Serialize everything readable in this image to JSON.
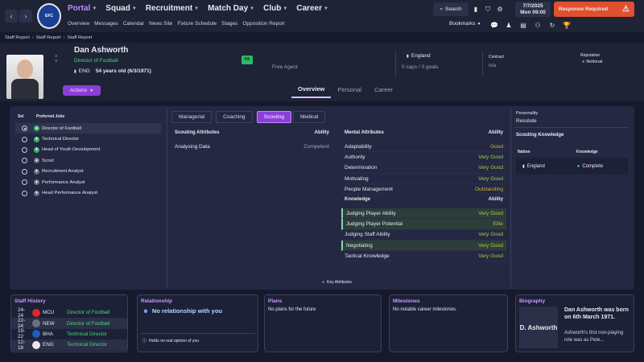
{
  "topbar": {
    "nav_items": [
      {
        "label": "Portal"
      },
      {
        "label": "Squad"
      },
      {
        "label": "Recruitment"
      },
      {
        "label": "Match Day"
      },
      {
        "label": "Club"
      },
      {
        "label": "Career"
      }
    ],
    "sub_nav": [
      "Overview",
      "Messages",
      "Calendar",
      "News Site",
      "Fixture Schedule",
      "Stages",
      "Opposition Report"
    ],
    "search_label": "Search",
    "date": "7/7/2025",
    "day_time": "Mon 09:00",
    "response_label": "Response Required",
    "bookmarks_label": "Bookmarks"
  },
  "breadcrumb": [
    "Staff Report",
    "Staff Report",
    "Staff Report"
  ],
  "profile": {
    "name": "Dan Ashworth",
    "role": "Director of Football",
    "nation_code": "ENG",
    "age": "54 years old (6/3/1971)",
    "fa_badge": "FA",
    "status": "Free Agent",
    "nation": "England",
    "caps": "0 caps / 0 goals",
    "contract_label": "Contract",
    "contract_value": "n/a",
    "reputation_label": "Reputation",
    "reputation_value": "Notional",
    "actions_label": "Actions"
  },
  "view_tabs": [
    "Overview",
    "Personal",
    "Career"
  ],
  "preferred_jobs": {
    "sel_header": "Sel",
    "jobs_header": "Preferred Jobs",
    "items": [
      {
        "label": "Director of Football",
        "selected": true
      },
      {
        "label": "Technical Director",
        "selected": false
      },
      {
        "label": "Head of Youth Development",
        "selected": false
      },
      {
        "label": "Scout",
        "selected": false
      },
      {
        "label": "Recruitment Analyst",
        "selected": false
      },
      {
        "label": "Performance Analyst",
        "selected": false
      },
      {
        "label": "Head Performance Analyst",
        "selected": false
      }
    ]
  },
  "attr_tabs": [
    "Managerial",
    "Coaching",
    "Scouting",
    "Medical"
  ],
  "scouting": {
    "header": "Scouting Attributes",
    "ability_header": "Ability",
    "rows": [
      {
        "name": "Analysing Data",
        "value": "Competent"
      }
    ]
  },
  "mental": {
    "header": "Mental Attributes",
    "ability_header": "Ability",
    "rows": [
      {
        "name": "Adaptability",
        "value": "Good"
      },
      {
        "name": "Authority",
        "value": "Very Good"
      },
      {
        "name": "Determination",
        "value": "Very Good"
      },
      {
        "name": "Motivating",
        "value": "Very Good"
      },
      {
        "name": "People Management",
        "value": "Outstanding"
      }
    ]
  },
  "knowledge": {
    "header": "Knowledge",
    "ability_header": "Ability",
    "rows": [
      {
        "name": "Judging Player Ability",
        "value": "Very Good",
        "key": true
      },
      {
        "name": "Judging Player Potential",
        "value": "Elite",
        "key": true
      },
      {
        "name": "Judging Staff Ability",
        "value": "Very Good",
        "key": false
      },
      {
        "name": "Negotiating",
        "value": "Very Good",
        "key": true
      },
      {
        "name": "Tactical Knowledge",
        "value": "Very Good",
        "key": false
      }
    ]
  },
  "key_attr_legend": "Key Attributes",
  "personality": {
    "label": "Personality",
    "value": "Resolute"
  },
  "scouting_knowledge": {
    "header": "Scouting Knowledge",
    "nation_header": "Nation",
    "knowledge_header": "Knowledge",
    "rows": [
      {
        "nation": "England",
        "value": "Complete"
      }
    ]
  },
  "staff_history": {
    "header": "Staff History",
    "rows": [
      {
        "years": "24-24",
        "club": "MCU",
        "role": "Director of Football",
        "crest_color": "#d9272e"
      },
      {
        "years": "22-24",
        "club": "NEW",
        "role": "Director of Football",
        "crest_color": "#6b6f80"
      },
      {
        "years": "19-22",
        "club": "BHA",
        "role": "Technical Director",
        "crest_color": "#1d5fbf"
      },
      {
        "years": "12-18",
        "club": "ENG",
        "role": "Technical Director",
        "crest_color": "#e8e9f0"
      }
    ]
  },
  "relationship": {
    "header": "Relationship",
    "text": "No relationship with you",
    "footer": "Holds no real opinion of you"
  },
  "plans": {
    "header": "Plans",
    "text": "No plans for the future"
  },
  "milestones": {
    "header": "Milestones",
    "text": "No notable career milestones."
  },
  "biography": {
    "header": "Biography",
    "name_card": "D. Ashworth",
    "headline": "Dan Ashworth was born on 6th March 1971.",
    "text": "Ashworth's first non-playing role was as Pete..."
  },
  "colors": {
    "accent": "#8a3fd9",
    "response": "#e0502f",
    "green": "#3ddc7b",
    "gold": "#d6b22c"
  }
}
